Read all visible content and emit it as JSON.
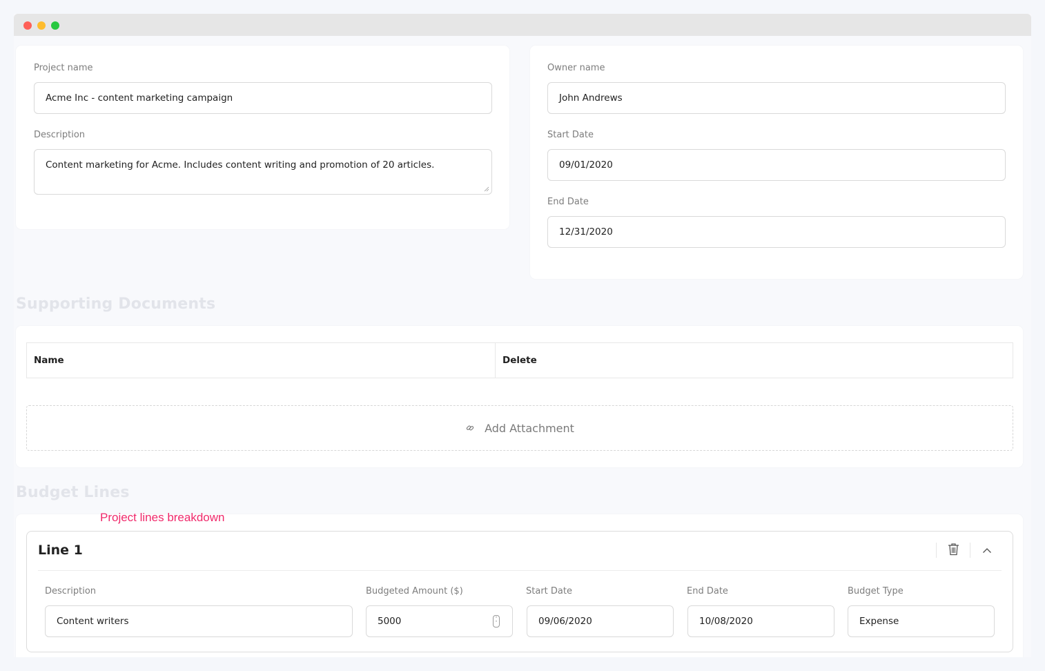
{
  "project": {
    "name_label": "Project name",
    "name_value": "Acme Inc - content marketing campaign",
    "description_label": "Description",
    "description_value": "Content marketing  for Acme. Includes content writing and promotion of 20 articles."
  },
  "owner": {
    "name_label": "Owner name",
    "name_value": "John Andrews",
    "start_label": "Start Date",
    "start_value": "09/01/2020",
    "end_label": "End Date",
    "end_value": "12/31/2020"
  },
  "documents": {
    "title": "Supporting Documents",
    "columns": [
      "Name",
      "Delete"
    ],
    "add_label": "Add Attachment"
  },
  "budget": {
    "title": "Budget Lines",
    "annotation": "Project lines breakdown",
    "line": {
      "title": "Line 1",
      "description_label": "Description",
      "description_value": "Content writers",
      "amount_label": "Budgeted Amount ($)",
      "amount_value": "5000",
      "start_label": "Start Date",
      "start_value": "09/06/2020",
      "end_label": "End Date",
      "end_value": "10/08/2020",
      "type_label": "Budget Type",
      "type_value": "Expense"
    }
  },
  "icons": {
    "attachment": "paperclip-icon",
    "delete": "trash-icon",
    "collapse": "chevron-up-icon"
  },
  "colors": {
    "annotation": "#f0296b",
    "section_title": "#e2e4ea"
  }
}
